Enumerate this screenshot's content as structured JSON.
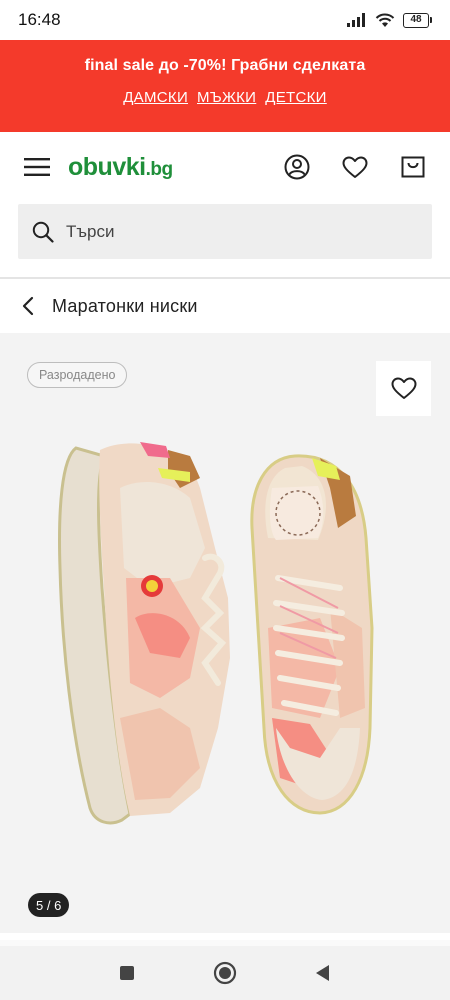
{
  "status_bar": {
    "time": "16:48",
    "battery": "48"
  },
  "promo": {
    "title": "final sale до -70%! Грабни сделката",
    "links": [
      "ДАМСКИ",
      "МЪЖКИ",
      "ДЕТСКИ"
    ]
  },
  "header": {
    "logo_main": "obuvki",
    "logo_tld": ".bg"
  },
  "search": {
    "placeholder": "Търси"
  },
  "breadcrumb": {
    "label": "Маратонки ниски"
  },
  "product": {
    "badge": "Разродадено",
    "image_counter": "5 / 6"
  },
  "colors": {
    "promo_bg": "#f43a2b",
    "logo_green": "#1f8f3a",
    "gallery_bg": "#f3f3f3"
  }
}
